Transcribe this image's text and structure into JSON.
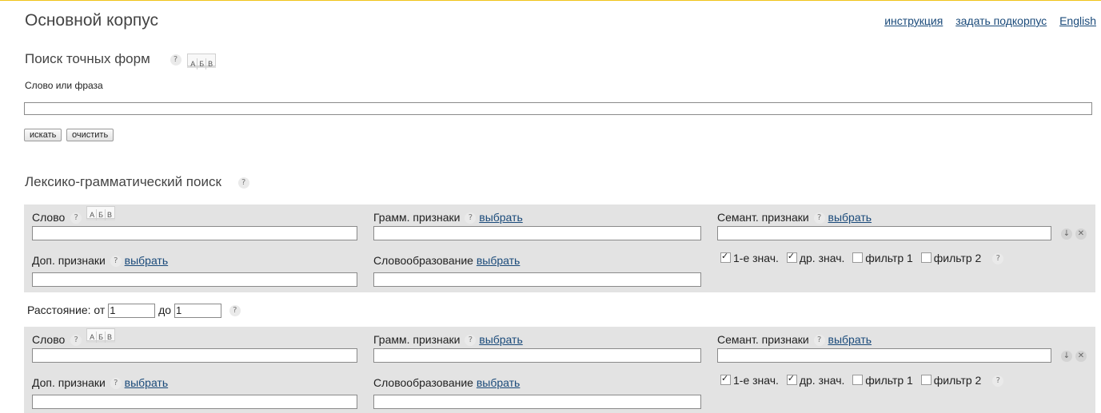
{
  "header": {
    "title": "Основной корпус",
    "links": [
      "инструкция",
      "задать подкорпус",
      "English"
    ]
  },
  "exact_search": {
    "title": "Поиск точных форм",
    "help": "?",
    "abv": [
      "А",
      "Б",
      "В"
    ],
    "field_label": "Слово или фраза",
    "input_value": "",
    "search_button": "искать",
    "clear_button": "очистить"
  },
  "lexgram": {
    "title": "Лексико-грамматический поиск",
    "help": "?"
  },
  "block_labels": {
    "word": "Слово",
    "gram": "Грамм. признаки",
    "semant": "Семант. признаки",
    "extra": "Доп. признаки",
    "wordform": "Словообразование",
    "choose": "выбрать",
    "help": "?",
    "abv": [
      "А",
      "Б",
      "В"
    ],
    "move_down": "↓",
    "remove": "✕"
  },
  "checkboxes": [
    {
      "label": "1-е знач.",
      "checked": true
    },
    {
      "label": "др. знач.",
      "checked": true
    },
    {
      "label": "фильтр 1",
      "checked": false
    },
    {
      "label": "фильтр 2",
      "checked": false
    }
  ],
  "distance": {
    "label": "Расстояние: от",
    "from": "1",
    "to_label": "до",
    "to": "1",
    "help": "?"
  }
}
